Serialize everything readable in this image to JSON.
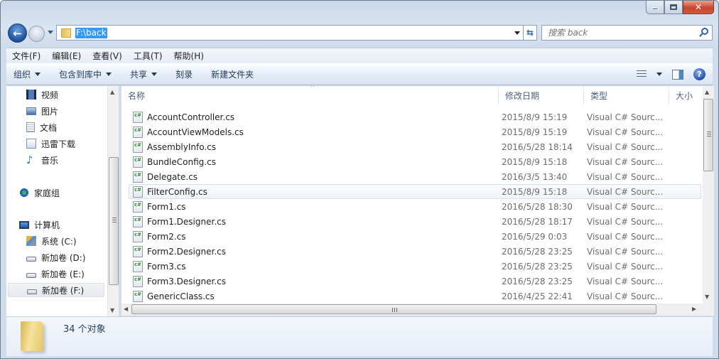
{
  "window": {
    "minimize": "minimize",
    "maximize": "maximize",
    "close": "✕"
  },
  "nav": {
    "back_icon": "←",
    "address_path": "F:\\back",
    "refresh_icon": "⇆",
    "search_placeholder": "搜索 back"
  },
  "menu": [
    "文件(F)",
    "编辑(E)",
    "查看(V)",
    "工具(T)",
    "帮助(H)"
  ],
  "commands": [
    {
      "label": "组织",
      "dropdown": true
    },
    {
      "label": "包含到库中",
      "dropdown": true
    },
    {
      "label": "共享",
      "dropdown": true
    },
    {
      "label": "刻录",
      "dropdown": false
    },
    {
      "label": "新建文件夹",
      "dropdown": false
    }
  ],
  "help_icon": "?",
  "sidebar": {
    "libraries": [
      {
        "label": "视频",
        "icon": "video-library-icon"
      },
      {
        "label": "图片",
        "icon": "pictures-library-icon"
      },
      {
        "label": "文档",
        "icon": "documents-library-icon"
      },
      {
        "label": "迅雷下载",
        "icon": "download-library-icon"
      },
      {
        "label": "音乐",
        "icon": "music-library-icon"
      }
    ],
    "homegroup": "家庭组",
    "computer": "计算机",
    "drives": [
      {
        "label": "系统 (C:)",
        "icon": "system-drive-icon"
      },
      {
        "label": "新加卷 (D:)",
        "icon": "drive-icon"
      },
      {
        "label": "新加卷 (E:)",
        "icon": "drive-icon"
      },
      {
        "label": "新加卷 (F:)",
        "icon": "drive-icon",
        "selected": true
      }
    ]
  },
  "columns": {
    "name": "名称",
    "modified": "修改日期",
    "type": "类型",
    "size": "大小"
  },
  "files": [
    {
      "name": "AccountController.cs",
      "modified": "2015/8/9 15:19",
      "type": "Visual C# Sourc..."
    },
    {
      "name": "AccountViewModels.cs",
      "modified": "2015/8/9 15:19",
      "type": "Visual C# Sourc..."
    },
    {
      "name": "AssemblyInfo.cs",
      "modified": "2016/5/28 18:14",
      "type": "Visual C# Sourc..."
    },
    {
      "name": "BundleConfig.cs",
      "modified": "2015/8/9 15:18",
      "type": "Visual C# Sourc..."
    },
    {
      "name": "Delegate.cs",
      "modified": "2016/3/5 13:40",
      "type": "Visual C# Sourc..."
    },
    {
      "name": "FilterConfig.cs",
      "modified": "2015/8/9 15:18",
      "type": "Visual C# Sourc...",
      "hover": true
    },
    {
      "name": "Form1.cs",
      "modified": "2016/5/28 18:30",
      "type": "Visual C# Sourc..."
    },
    {
      "name": "Form1.Designer.cs",
      "modified": "2016/5/28 18:17",
      "type": "Visual C# Sourc..."
    },
    {
      "name": "Form2.cs",
      "modified": "2016/5/29 0:03",
      "type": "Visual C# Sourc..."
    },
    {
      "name": "Form2.Designer.cs",
      "modified": "2016/5/28 23:25",
      "type": "Visual C# Sourc..."
    },
    {
      "name": "Form3.cs",
      "modified": "2016/5/28 23:25",
      "type": "Visual C# Sourc..."
    },
    {
      "name": "Form3.Designer.cs",
      "modified": "2016/5/28 23:25",
      "type": "Visual C# Sourc..."
    },
    {
      "name": "GenericClass.cs",
      "modified": "2016/4/25 22:41",
      "type": "Visual C# Sourc..."
    }
  ],
  "file_icon_text": "c#",
  "status": {
    "count_text": "34 个对象"
  }
}
